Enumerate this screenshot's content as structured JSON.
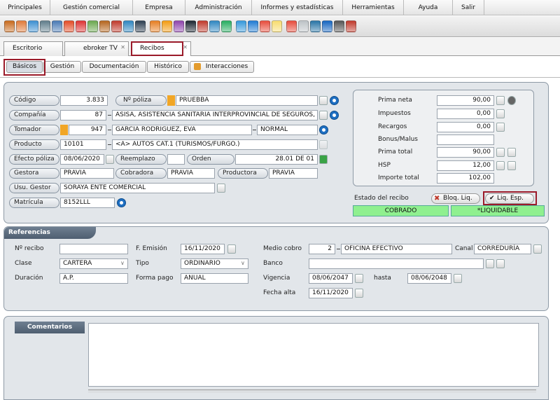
{
  "menu": [
    "Principales",
    "Gestión comercial",
    "Empresa",
    "Administración",
    "Informes y estadísticas",
    "Herramientas",
    "Ayuda",
    "Salir"
  ],
  "toolbar_icons": [
    "open-box-icon",
    "user-icon",
    "user-pin-icon",
    "card-icon",
    "window-icon",
    "fire-icon",
    "target-icon",
    "check-icon",
    "briefcase-icon",
    "gift-icon",
    "arrow-icon",
    "paper-icon",
    "person-red-icon",
    "person-orange-icon",
    "people-icon",
    "soccer-icon",
    "car-icon",
    "euro-icon",
    "diamond-icon",
    "arrows-icon",
    "refresh-icon",
    "google-icon",
    "bulb-icon",
    "pdf-icon",
    "notepad-icon",
    "map-icon",
    "phone-icon",
    "tools-icon",
    "help-icon"
  ],
  "tabs": [
    {
      "label": "Escritorio"
    },
    {
      "label": "ebroker TV"
    },
    {
      "label": "Recibos"
    }
  ],
  "subtabs": [
    "Básicos",
    "Gestión",
    "Documentación",
    "Histórico",
    "Interacciones"
  ],
  "basicos": {
    "codigo_label": "Código",
    "codigo": "3.833",
    "poliza_label": "Nº póliza",
    "poliza": "PRUEBBA",
    "compania_label": "Compañía",
    "compania_code": "87",
    "compania": "ASISA, ASISTENCIA SANITARIA INTERPROVINCIAL DE SEGUROS, S.A.",
    "tomador_label": "Tomador",
    "tomador_code": "947",
    "tomador": "GARCIA RODRIGUEZ, EVA",
    "tomador_type": "NORMAL",
    "producto_label": "Producto",
    "producto_code": "10101",
    "producto": "<A> AUTOS CAT.1 (TURISMOS/FURGO.)",
    "efecto_label": "Efecto póliza",
    "efecto": "08/06/2020",
    "reemplazo_label": "Reemplazo",
    "orden_label": "Orden",
    "orden": "28.01 DE 01",
    "gestora_label": "Gestora",
    "gestora": "PRAVIA",
    "cobradora_label": "Cobradora",
    "cobradora": "PRAVIA",
    "productora_label": "Productora",
    "productora": "PRAVIA",
    "usu_gestor_label": "Usu. Gestor",
    "usu_gestor": "SORAYA ENTE COMERCIAL",
    "matricula_label": "Matrícula",
    "matricula": "8152LLL"
  },
  "importes": [
    {
      "label": "Prima neta",
      "value": "90,00"
    },
    {
      "label": "Impuestos",
      "value": "0,00"
    },
    {
      "label": "Recargos",
      "value": "0,00"
    },
    {
      "label": "Bonus/Malus",
      "value": ""
    },
    {
      "label": "Prima total",
      "value": "90,00"
    },
    {
      "label": "HSP",
      "value": "12,00"
    },
    {
      "label": "Importe total",
      "value": "102,00"
    }
  ],
  "estado": {
    "label": "Estado del recibo",
    "bloq": "Bloq. Liq.",
    "liq": "Liq. Esp.",
    "cobrado": "COBRADO",
    "liquidable": "*LIQUIDABLE",
    "accent": "#8ff08f"
  },
  "referencias": {
    "title": "Referencias",
    "recibo_label": "Nº recibo",
    "recibo": "",
    "clase_label": "Clase",
    "clase": "CARTERA",
    "duracion_label": "Duración",
    "duracion": "A.P.",
    "emision_label": "F. Emisión",
    "emision": "16/11/2020",
    "tipo_label": "Tipo",
    "tipo": "ORDINARIO",
    "forma_pago_label": "Forma pago",
    "forma_pago": "ANUAL",
    "medio_cobro_label": "Medio cobro",
    "medio_cobro_code": "2",
    "medio_cobro": "OFICINA EFECTIVO",
    "canal_label": "Canal",
    "canal": "CORREDURÍA",
    "banco_label": "Banco",
    "banco": "",
    "vigencia_label": "Vigencia",
    "vigencia_desde": "08/06/2047",
    "hasta_label": "hasta",
    "vigencia_hasta": "08/06/2048",
    "fecha_alta_label": "Fecha alta",
    "fecha_alta": "16/11/2020"
  },
  "comentarios": {
    "title": "Comentarios"
  }
}
